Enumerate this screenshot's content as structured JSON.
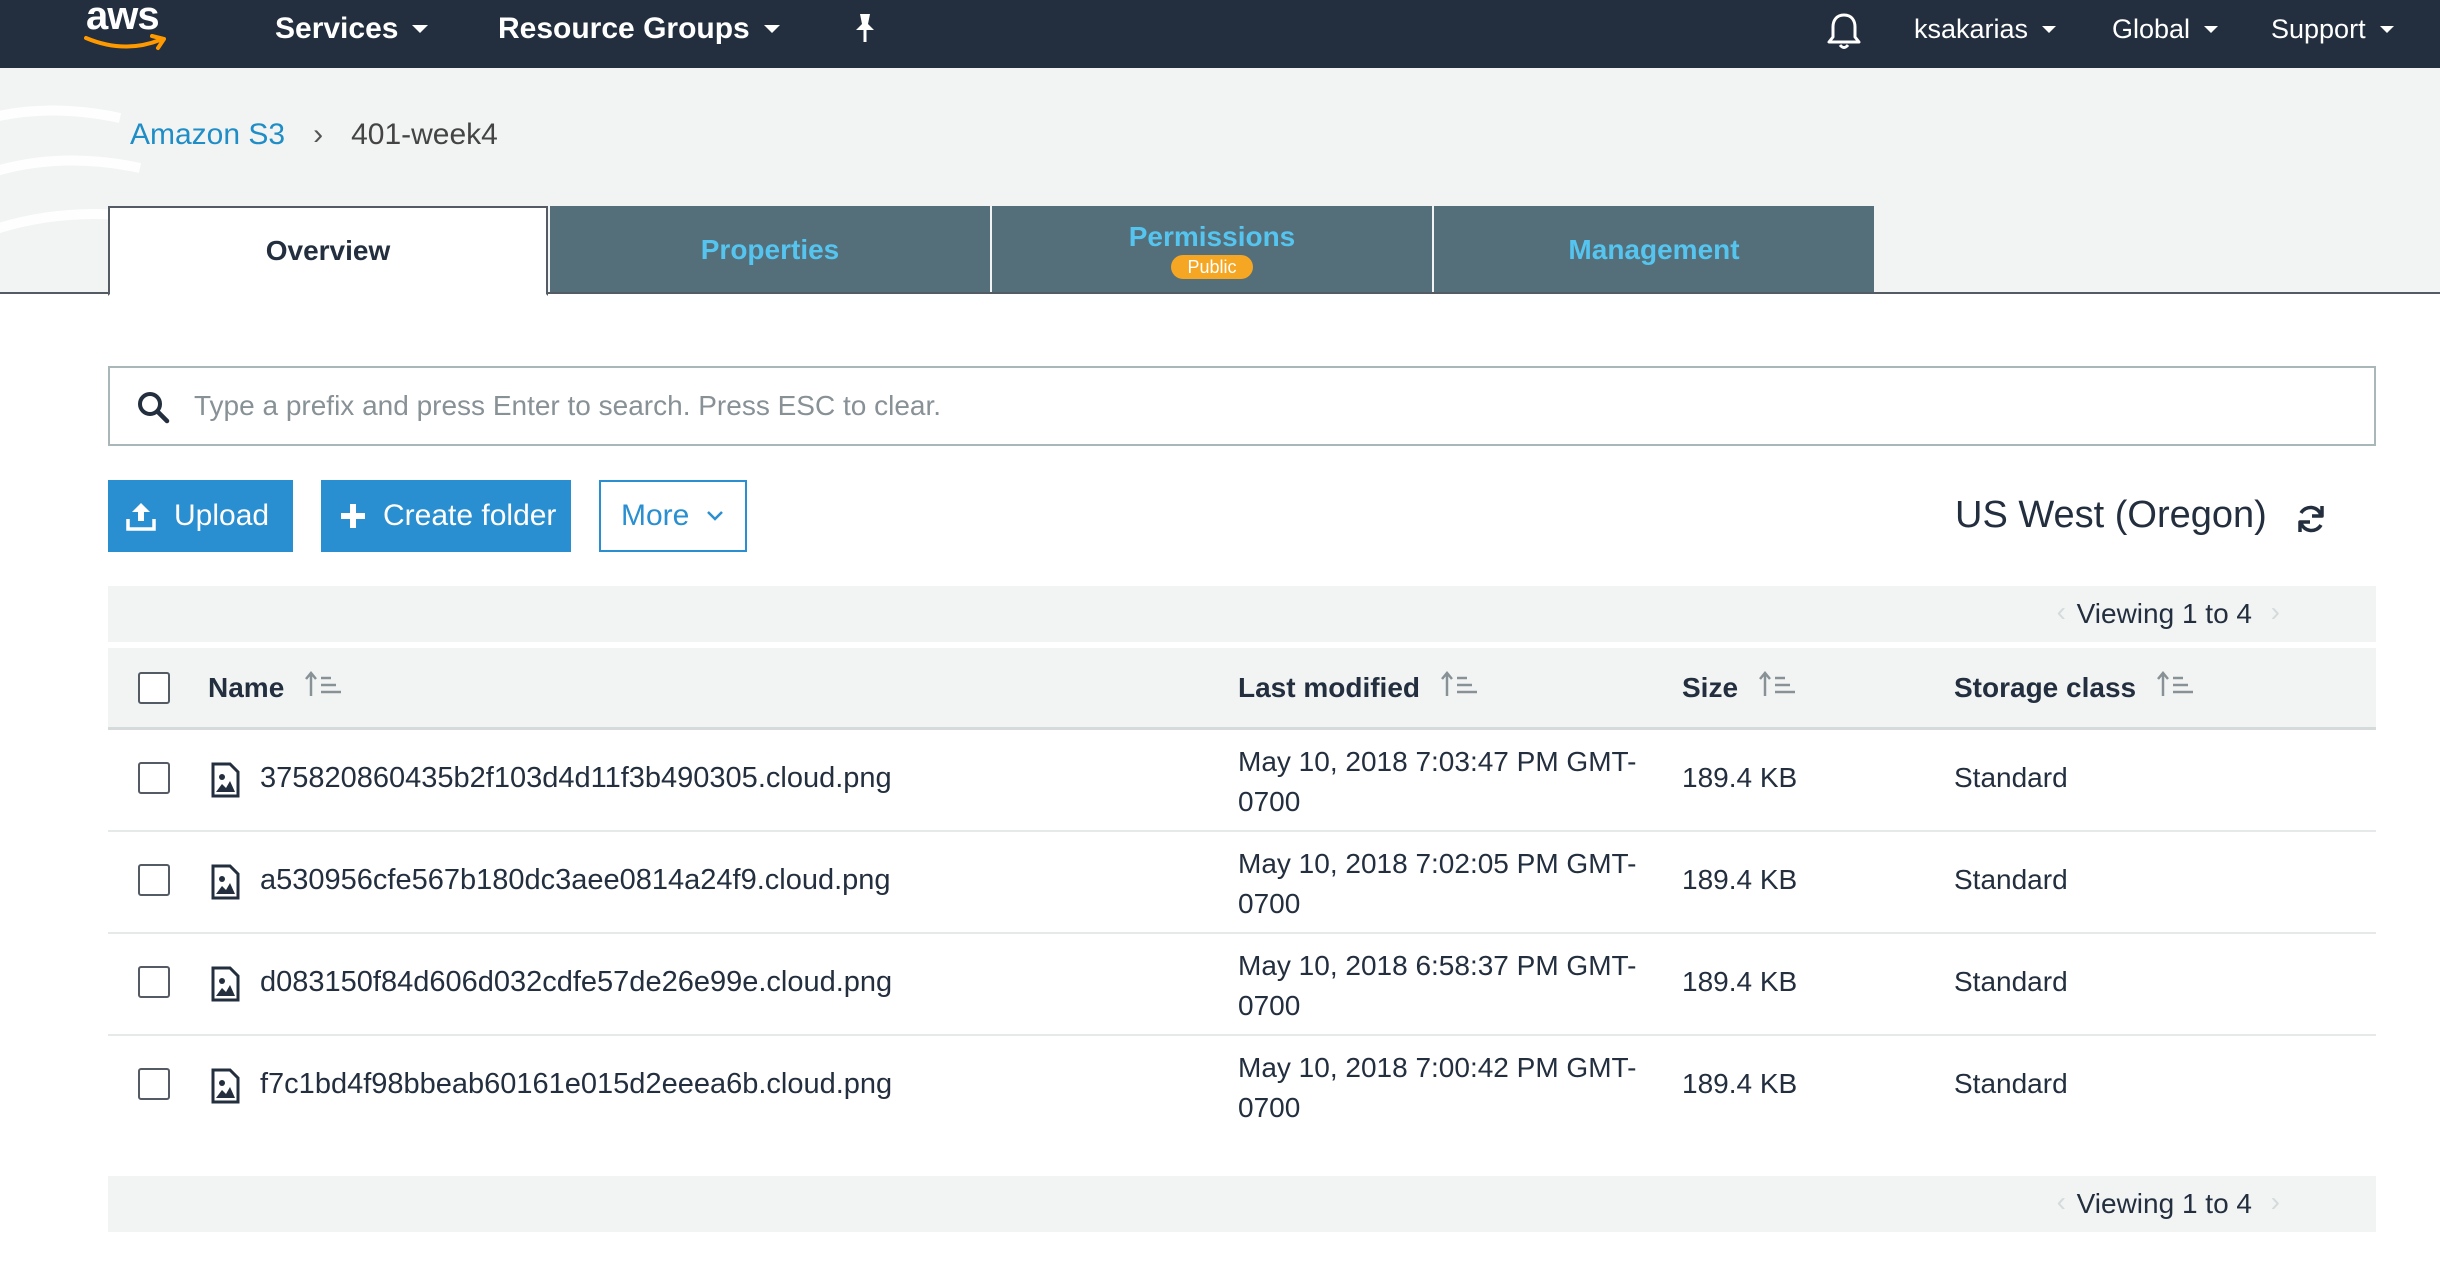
{
  "topbar": {
    "logo_text": "aws",
    "services_label": "Services",
    "resource_groups_label": "Resource Groups",
    "user_label": "ksakarias",
    "region_menu_label": "Global",
    "support_label": "Support"
  },
  "breadcrumb": {
    "root": "Amazon S3",
    "separator": "›",
    "current": "401-week4"
  },
  "tabs": [
    {
      "label": "Overview",
      "active": true
    },
    {
      "label": "Properties"
    },
    {
      "label": "Permissions",
      "badge": "Public"
    },
    {
      "label": "Management"
    }
  ],
  "search": {
    "placeholder": "Type a prefix and press Enter to search. Press ESC to clear.",
    "value": ""
  },
  "toolbar": {
    "upload_label": "Upload",
    "create_folder_label": "Create folder",
    "more_label": "More",
    "region": "US West (Oregon)"
  },
  "pagination": {
    "top": "Viewing 1 to 4",
    "bottom": "Viewing 1 to 4"
  },
  "table": {
    "columns": [
      "Name",
      "Last modified",
      "Size",
      "Storage class"
    ],
    "rows": [
      {
        "name": "375820860435b2f103d4d11f3b490305.cloud.png",
        "modified": "May 10, 2018 7:03:47 PM GMT-0700",
        "size": "189.4 KB",
        "storage_class": "Standard"
      },
      {
        "name": "a530956cfe567b180dc3aee0814a24f9.cloud.png",
        "modified": "May 10, 2018 7:02:05 PM GMT-0700",
        "size": "189.4 KB",
        "storage_class": "Standard"
      },
      {
        "name": "d083150f84d606d032cdfe57de26e99e.cloud.png",
        "modified": "May 10, 2018 6:58:37 PM GMT-0700",
        "size": "189.4 KB",
        "storage_class": "Standard"
      },
      {
        "name": "f7c1bd4f98bbeab60161e015d2eeea6b.cloud.png",
        "modified": "May 10, 2018 7:00:42 PM GMT-0700",
        "size": "189.4 KB",
        "storage_class": "Standard"
      }
    ]
  },
  "colors": {
    "topbar_bg": "#232f3e",
    "link": "#1f8dc6",
    "tab_bg": "#546e7a",
    "tab_text": "#55c5f0",
    "badge": "#f5a623",
    "primary_button": "#2a8fd0"
  }
}
